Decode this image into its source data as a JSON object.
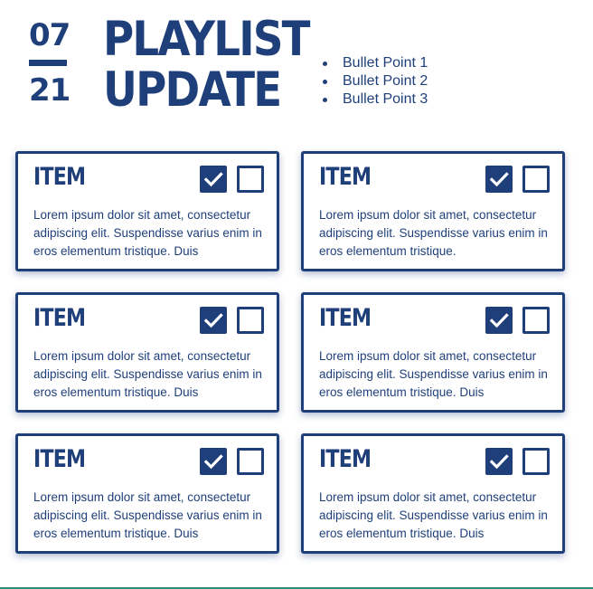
{
  "header": {
    "date_top": "07",
    "date_bottom": "21",
    "title_line1": "PLAYLIST",
    "title_line2": "UPDATE",
    "bullets": [
      "Bullet Point 1",
      "Bullet Point 2",
      "Bullet Point 3"
    ]
  },
  "cards": [
    {
      "title": "ITEM",
      "text": "Lorem ipsum dolor sit amet, consectetur adipiscing elit. Suspendisse varius enim in eros elementum tristique. Duis",
      "checked_icon": "checkbox-checked-icon",
      "unchecked_icon": "checkbox-empty-icon"
    },
    {
      "title": "ITEM",
      "text": "Lorem ipsum dolor sit amet, consectetur adipiscing elit. Suspendisse varius enim in eros elementum tristique.",
      "checked_icon": "checkbox-checked-icon",
      "unchecked_icon": "checkbox-empty-icon"
    },
    {
      "title": "ITEM",
      "text": "Lorem ipsum dolor sit amet, consectetur adipiscing elit. Suspendisse varius enim in eros elementum tristique. Duis",
      "checked_icon": "checkbox-checked-icon",
      "unchecked_icon": "checkbox-empty-icon"
    },
    {
      "title": "ITEM",
      "text": "Lorem ipsum dolor sit amet, consectetur adipiscing elit. Suspendisse varius enim in eros elementum tristique. Duis",
      "checked_icon": "checkbox-checked-icon",
      "unchecked_icon": "checkbox-empty-icon"
    },
    {
      "title": "ITEM",
      "text": "Lorem ipsum dolor sit amet, consectetur adipiscing elit. Suspendisse varius enim in eros elementum tristique. Duis",
      "checked_icon": "checkbox-checked-icon",
      "unchecked_icon": "checkbox-empty-icon"
    },
    {
      "title": "ITEM",
      "text": "Lorem ipsum dolor sit amet, consectetur adipiscing elit. Suspendisse varius enim in eros elementum tristique. Duis",
      "checked_icon": "checkbox-checked-icon",
      "unchecked_icon": "checkbox-empty-icon"
    }
  ],
  "colors": {
    "primary": "#1f3f7a",
    "background": "#ffffff",
    "footer_line": "#2c8a7a"
  }
}
